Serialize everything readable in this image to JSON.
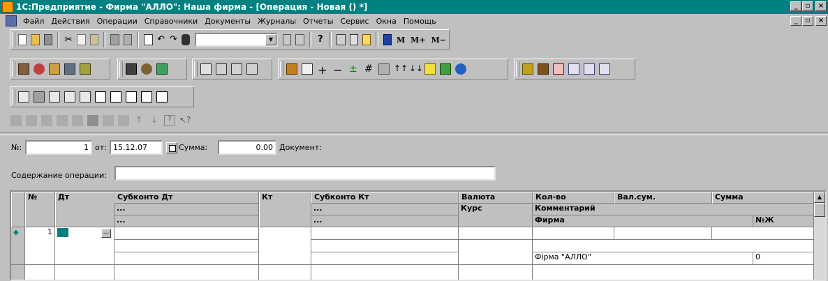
{
  "window": {
    "title": "1С:Предприятие - Фирма \"АЛЛО\": Наша фирма - [Операция - Новая () *]",
    "controls": [
      "_",
      "▫",
      "×"
    ]
  },
  "menu": {
    "items": [
      "Файл",
      "Действия",
      "Операции",
      "Справочники",
      "Документы",
      "Журналы",
      "Отчеты",
      "Сервис",
      "Окна",
      "Помощь"
    ]
  },
  "toolbar": {
    "search_value": "",
    "m_buttons": [
      "M",
      "M+",
      "M−"
    ]
  },
  "form": {
    "num_label": "№:",
    "num_value": "1",
    "date_label": "от:",
    "date_value": "15.12.07",
    "sum_label": "Сумма:",
    "sum_value": "0.00",
    "doc_label": "Документ:",
    "content_label": "Содержание операции:",
    "content_value": ""
  },
  "table": {
    "headers": {
      "num": "№",
      "dt": "Дт",
      "subkonto_dt": "Субконто Дт",
      "kt": "Кт",
      "subkonto_kt": "Субконто Кт",
      "currency": "Валюта",
      "qty": "Кол-во",
      "cur_sum": "Вал.сум.",
      "sum": "Сумма",
      "rate": "Курс",
      "comment": "Комментарий",
      "firm": "Фирма",
      "nzh": "№Ж",
      "ellipsis": "..."
    },
    "rows": [
      {
        "num": "1",
        "firm": "Фірма \"АЛЛО\"",
        "nzh": "0"
      }
    ]
  }
}
